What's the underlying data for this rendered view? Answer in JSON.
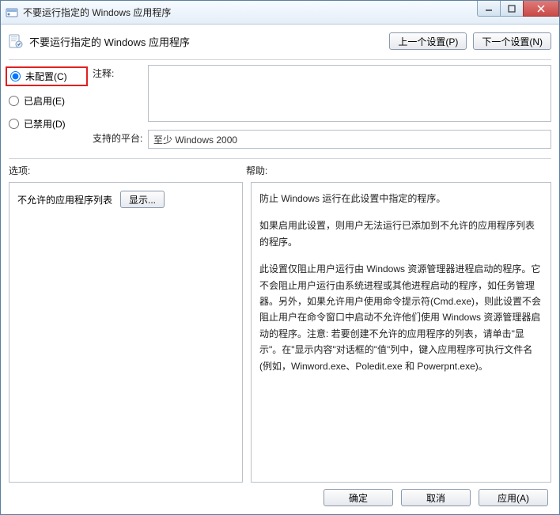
{
  "window": {
    "title": "不要运行指定的 Windows 应用程序"
  },
  "header": {
    "title": "不要运行指定的 Windows 应用程序",
    "prev": "上一个设置(P)",
    "next": "下一个设置(N)"
  },
  "radios": {
    "not_configured": "未配置(C)",
    "enabled": "已启用(E)",
    "disabled": "已禁用(D)",
    "selected": "not_configured"
  },
  "labels": {
    "comment": "注释:",
    "platform": "支持的平台:",
    "options": "选项:",
    "help": "帮助:"
  },
  "platform_value": "至少 Windows 2000",
  "options": {
    "disallowed_list": "不允许的应用程序列表",
    "show_button": "显示..."
  },
  "help": {
    "p1": "防止 Windows 运行在此设置中指定的程序。",
    "p2": "如果启用此设置，则用户无法运行已添加到不允许的应用程序列表的程序。",
    "p3": "此设置仅阻止用户运行由 Windows 资源管理器进程启动的程序。它不会阻止用户运行由系统进程或其他进程启动的程序，如任务管理器。另外，如果允许用户使用命令提示符(Cmd.exe)，则此设置不会阻止用户在命令窗口中启动不允许他们使用 Windows 资源管理器启动的程序。注意: 若要创建不允许的应用程序的列表，请单击\"显示\"。在\"显示内容\"对话框的\"值\"列中，键入应用程序可执行文件名(例如，Winword.exe、Poledit.exe 和 Powerpnt.exe)。"
  },
  "buttons": {
    "ok": "确定",
    "cancel": "取消",
    "apply": "应用(A)"
  }
}
